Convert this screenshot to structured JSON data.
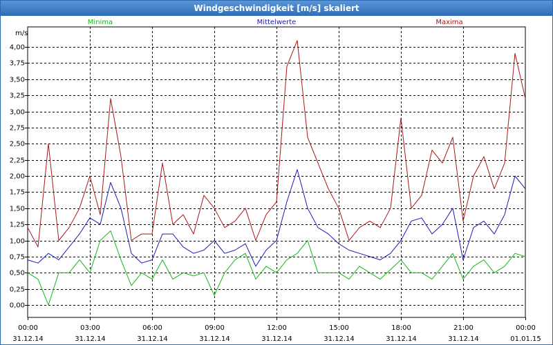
{
  "window": {
    "title": "Windgeschwindigkeit [m/s] skaliert"
  },
  "colors": {
    "minima": "#12b812",
    "mittelwerte": "#1a1ab8",
    "maxima": "#aa1414",
    "grid": "#000000",
    "frame": "#2e6ab0"
  },
  "chart_data": {
    "type": "line",
    "ylabel": "m/s",
    "ylim": [
      0,
      4.25
    ],
    "yticks": [
      "0,00",
      "0,25",
      "0,50",
      "0,75",
      "1,00",
      "1,25",
      "1,50",
      "1,75",
      "2,00",
      "2,25",
      "2,50",
      "2,75",
      "3,00",
      "3,25",
      "3,50",
      "3,75",
      "4,00"
    ],
    "grid": true,
    "legend_placement": "top",
    "xlim_hours": [
      0,
      24
    ],
    "xticks": [
      {
        "time": "00:00",
        "date": "31.12.14"
      },
      {
        "time": "03:00",
        "date": "31.12.14"
      },
      {
        "time": "06:00",
        "date": "31.12.14"
      },
      {
        "time": "09:00",
        "date": "31.12.14"
      },
      {
        "time": "12:00",
        "date": "31.12.14"
      },
      {
        "time": "15:00",
        "date": "31.12.14"
      },
      {
        "time": "18:00",
        "date": "31.12.14"
      },
      {
        "time": "21:00",
        "date": "31.12.14"
      },
      {
        "time": "00:00",
        "date": "01.01.15"
      }
    ],
    "series": [
      {
        "name": "Minima",
        "x_hours": [
          0.0,
          0.5,
          1.0,
          1.5,
          2.0,
          2.5,
          3.0,
          3.5,
          4.0,
          4.5,
          5.0,
          5.5,
          6.0,
          6.5,
          7.0,
          7.5,
          8.0,
          8.5,
          9.0,
          9.5,
          10.0,
          10.5,
          11.0,
          11.5,
          12.0,
          12.5,
          13.0,
          13.5,
          14.0,
          14.5,
          15.0,
          15.5,
          16.0,
          16.5,
          17.0,
          17.5,
          18.0,
          18.5,
          19.0,
          19.5,
          20.0,
          20.5,
          21.0,
          21.5,
          22.0,
          22.5,
          23.0,
          23.5,
          24.0
        ],
        "values": [
          0.5,
          0.4,
          0.0,
          0.5,
          0.5,
          0.7,
          0.5,
          1.0,
          1.15,
          0.7,
          0.3,
          0.5,
          0.4,
          0.7,
          0.4,
          0.5,
          0.45,
          0.5,
          0.15,
          0.5,
          0.7,
          0.8,
          0.4,
          0.6,
          0.5,
          0.7,
          0.8,
          1.0,
          0.5,
          0.5,
          0.5,
          0.4,
          0.6,
          0.5,
          0.4,
          0.55,
          0.7,
          0.5,
          0.5,
          0.4,
          0.6,
          0.8,
          0.4,
          0.6,
          0.7,
          0.5,
          0.6,
          0.8,
          0.75
        ]
      },
      {
        "name": "Mittelwerte",
        "x_hours": [
          0.0,
          0.5,
          1.0,
          1.5,
          2.0,
          2.5,
          3.0,
          3.5,
          4.0,
          4.5,
          5.0,
          5.5,
          6.0,
          6.5,
          7.0,
          7.5,
          8.0,
          8.5,
          9.0,
          9.5,
          10.0,
          10.5,
          11.0,
          11.5,
          12.0,
          12.5,
          13.0,
          13.5,
          14.0,
          14.5,
          15.0,
          15.5,
          16.0,
          16.5,
          17.0,
          17.5,
          18.0,
          18.5,
          19.0,
          19.5,
          20.0,
          20.5,
          21.0,
          21.5,
          22.0,
          22.5,
          23.0,
          23.5,
          24.0
        ],
        "values": [
          0.7,
          0.65,
          0.8,
          0.7,
          0.9,
          1.1,
          1.35,
          1.25,
          1.9,
          1.5,
          0.8,
          0.65,
          0.7,
          1.1,
          1.1,
          0.9,
          0.8,
          0.85,
          1.0,
          0.8,
          0.85,
          0.95,
          0.6,
          0.85,
          1.0,
          1.6,
          2.1,
          1.5,
          1.2,
          1.1,
          0.95,
          0.85,
          0.8,
          0.75,
          0.7,
          0.8,
          1.0,
          1.3,
          1.35,
          1.1,
          1.25,
          1.5,
          0.7,
          1.2,
          1.3,
          1.1,
          1.4,
          2.0,
          1.8
        ]
      },
      {
        "name": "Maxima",
        "x_hours": [
          0.0,
          0.5,
          1.0,
          1.5,
          2.0,
          2.5,
          3.0,
          3.5,
          4.0,
          4.5,
          5.0,
          5.5,
          6.0,
          6.5,
          7.0,
          7.5,
          8.0,
          8.5,
          9.0,
          9.5,
          10.0,
          10.5,
          11.0,
          11.5,
          12.0,
          12.5,
          13.0,
          13.5,
          14.0,
          14.5,
          15.0,
          15.5,
          16.0,
          16.5,
          17.0,
          17.5,
          18.0,
          18.5,
          19.0,
          19.5,
          20.0,
          20.5,
          21.0,
          21.5,
          22.0,
          22.5,
          23.0,
          23.5,
          24.0
        ],
        "values": [
          1.2,
          0.9,
          2.5,
          1.0,
          1.2,
          1.5,
          2.0,
          1.4,
          3.2,
          2.3,
          1.0,
          1.1,
          1.1,
          2.2,
          1.25,
          1.4,
          1.1,
          1.7,
          1.5,
          1.2,
          1.3,
          1.5,
          1.0,
          1.4,
          1.6,
          3.7,
          4.1,
          2.6,
          2.2,
          1.8,
          1.5,
          1.0,
          1.2,
          1.3,
          1.2,
          1.5,
          2.9,
          1.5,
          1.7,
          2.4,
          2.2,
          2.6,
          1.3,
          2.0,
          2.3,
          1.8,
          2.2,
          3.9,
          3.2
        ]
      }
    ]
  }
}
